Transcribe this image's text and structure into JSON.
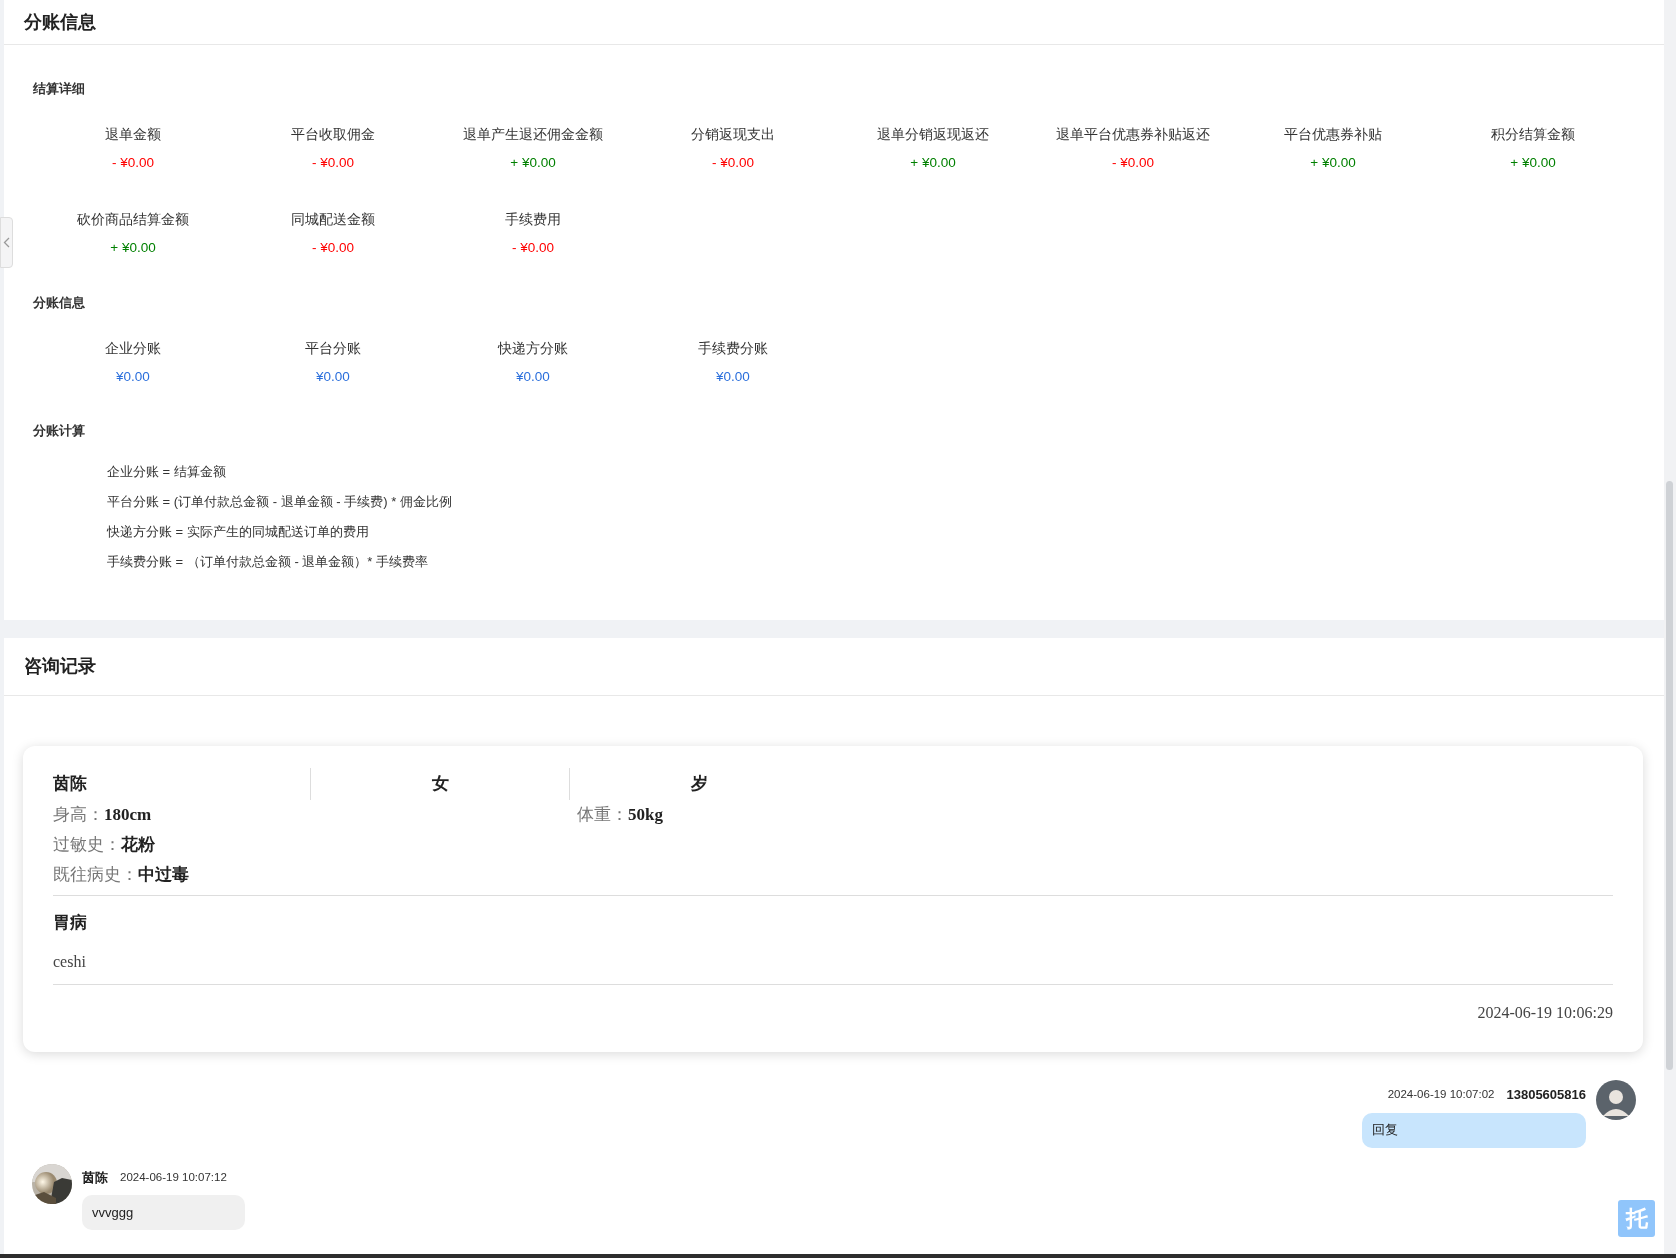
{
  "split_panel": {
    "title": "分账信息",
    "settlement": {
      "title": "结算详细",
      "items": [
        {
          "label": "退单金额",
          "value": "- ¥0.00",
          "kind": "debit"
        },
        {
          "label": "平台收取佣金",
          "value": "- ¥0.00",
          "kind": "debit"
        },
        {
          "label": "退单产生退还佣金金额",
          "value": "+ ¥0.00",
          "kind": "credit"
        },
        {
          "label": "分销返现支出",
          "value": "- ¥0.00",
          "kind": "debit"
        },
        {
          "label": "退单分销返现返还",
          "value": "+ ¥0.00",
          "kind": "credit"
        },
        {
          "label": "退单平台优惠券补贴返还",
          "value": "- ¥0.00",
          "kind": "debit"
        },
        {
          "label": "平台优惠券补贴",
          "value": "+ ¥0.00",
          "kind": "credit"
        },
        {
          "label": "积分结算金额",
          "value": "+ ¥0.00",
          "kind": "credit"
        },
        {
          "label": "砍价商品结算金额",
          "value": "+ ¥0.00",
          "kind": "credit"
        },
        {
          "label": "同城配送金额",
          "value": "- ¥0.00",
          "kind": "debit"
        },
        {
          "label": "手续费用",
          "value": "- ¥0.00",
          "kind": "debit"
        }
      ]
    },
    "split": {
      "title": "分账信息",
      "items": [
        {
          "label": "企业分账",
          "value": "¥0.00",
          "kind": "share"
        },
        {
          "label": "平台分账",
          "value": "¥0.00",
          "kind": "share"
        },
        {
          "label": "快递方分账",
          "value": "¥0.00",
          "kind": "share"
        },
        {
          "label": "手续费分账",
          "value": "¥0.00",
          "kind": "share"
        }
      ]
    },
    "formulas": {
      "title": "分账计算",
      "lines": [
        "企业分账 = 结算金额",
        "平台分账 = (订单付款总金额 - 退单金额 - 手续费) * 佣金比例",
        "快递方分账 = 实际产生的同城配送订单的费用",
        "手续费分账 = （订单付款总金额 - 退单金额）* 手续费率"
      ]
    }
  },
  "consult_panel": {
    "title": "咨询记录",
    "card": {
      "name": "茵陈",
      "gender": "女",
      "age": "岁",
      "fields": [
        {
          "label": "身高：",
          "value": "180cm"
        },
        {
          "label": "体重：",
          "value": "50kg"
        },
        {
          "label": "过敏史：",
          "value": "花粉"
        },
        {
          "label": "既往病史：",
          "value": "中过毒"
        }
      ],
      "condition": "胃病",
      "description": "ceshi",
      "time": "2024-06-19 10:06:29"
    },
    "messages": [
      {
        "kind": "outgoing",
        "time": "2024-06-19 10:07:02",
        "sender": "13805605816",
        "text": "回复"
      },
      {
        "kind": "incoming",
        "sender": "茵陈",
        "time": "2024-06-19 10:07:12",
        "text": "vvvggg"
      }
    ]
  },
  "float_button": "托"
}
